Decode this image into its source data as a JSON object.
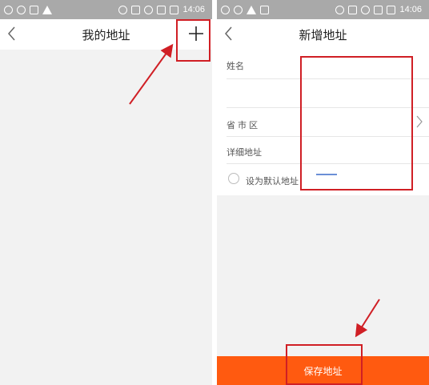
{
  "status_bar": {
    "time": "14:06"
  },
  "left_screen": {
    "title": "我的地址"
  },
  "right_screen": {
    "title": "新增地址",
    "fields": {
      "name_label": "姓名",
      "region_label": "省 市 区",
      "detail_label": "详细地址",
      "default_label": "设为默认地址"
    },
    "save_label": "保存地址"
  },
  "colors": {
    "annotation_red": "#d01f25",
    "save_button_orange": "#ff5a10",
    "status_bar_gray": "#a9a9a9"
  }
}
